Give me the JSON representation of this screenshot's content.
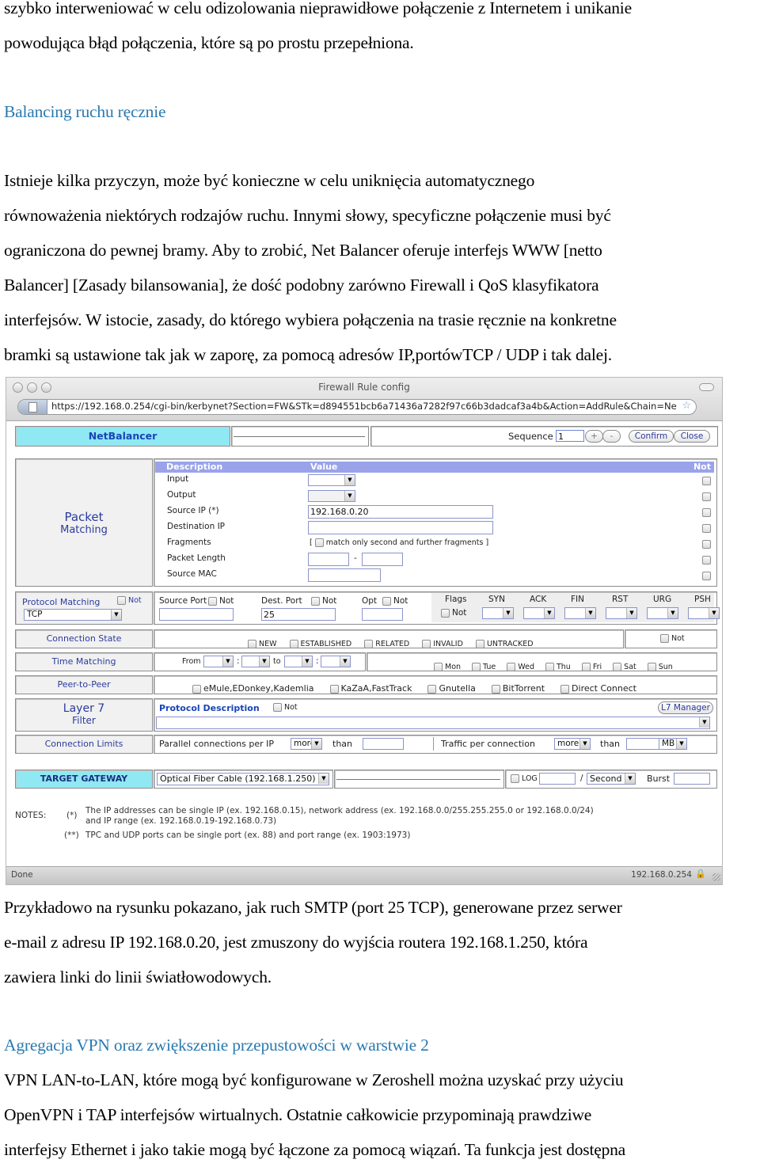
{
  "document": {
    "para_intro": [
      "szybko interweniować w celu odizolowania nieprawidłowe połączenie z Internetem i unikanie",
      "powodująca błąd połączenia, które są po prostu przepełniona."
    ],
    "heading_1": "Balancing ruchu ręcznie",
    "para_1": [
      "Istnieje kilka przyczyn, może być konieczne w celu uniknięcia automatycznego",
      "równoważenia niektórych rodzajów ruchu. Innymi słowy, specyficzne połączenie musi być",
      "ograniczona do pewnej bramy. Aby to zrobić, Net Balancer oferuje interfejs WWW [netto",
      "Balancer] [Zasady bilansowania], że dość podobny zarówno Firewall i QoS klasyfikatora",
      "interfejsów. W istocie, zasady, do którego wybiera połączenia na trasie ręcznie na konkretne",
      "bramki są ustawione tak jak w zaporę, za pomocą adresów IP,portówTCP / UDP i tak dalej."
    ],
    "para_2": [
      "Przykładowo na rysunku pokazano, jak ruch SMTP (port 25 TCP), generowane przez serwer",
      "e-mail z adresu IP 192.168.0.20, jest zmuszony do wyjścia routera 192.168.1.250, która",
      "zawiera linki do linii światłowodowych."
    ],
    "heading_2": "Agregacja VPN oraz zwiększenie przepustowości w warstwie 2",
    "para_3": [
      "VPN LAN-to-LAN, które mogą być konfigurowane w Zeroshell można uzyskać przy użyciu",
      "OpenVPN i TAP interfejsów wirtualnych. Ostatnie całkowicie przypominają prawdziwe",
      "interfejsy Ethernet i jako takie mogą być łączone za pomocą wiązań. Ta funkcja jest dostępna"
    ]
  },
  "browser": {
    "window_title": "Firewall Rule config",
    "url": "https://192.168.0.254/cgi-bin/kerbynet?Section=FW&STk=d894551bcb6a71436a7282f97c66b3dadcaf3a4b&Action=AddRule&Chain=NetBala",
    "status_left": "Done",
    "status_right": "192.168.0.254"
  },
  "form": {
    "header": {
      "title": "NetBalancer",
      "sequence_label": "Sequence",
      "sequence_value": "1",
      "plus_label": "+",
      "minus_label": "-",
      "confirm_label": "Confirm",
      "close_label": "Close"
    },
    "packet_matching": {
      "section_label_1": "Packet",
      "section_label_2": "Matching",
      "col_description": "Description",
      "col_value": "Value",
      "col_not": "Not",
      "rows": [
        {
          "label": "Input",
          "value": ""
        },
        {
          "label": "Output",
          "value": ""
        },
        {
          "label": "Source IP (*)",
          "value": "192.168.0.20"
        },
        {
          "label": "Destination IP",
          "value": ""
        },
        {
          "label": "Fragments",
          "value": "match only second and further fragments"
        },
        {
          "label": "Packet Length",
          "value": ""
        },
        {
          "label": "Source MAC",
          "value": ""
        }
      ],
      "fragments_open": "[",
      "fragments_close": "]",
      "length_sep": "-"
    },
    "protocol": {
      "label": "Protocol Matching",
      "not_label": "Not",
      "value": "TCP",
      "source_port_label": "Source Port",
      "source_port_value": "",
      "dest_port_label": "Dest. Port",
      "dest_port_value": "25",
      "opt_label": "Opt",
      "opt_value": "",
      "flags_label": "Flags",
      "flags": [
        "SYN",
        "ACK",
        "FIN",
        "RST",
        "URG",
        "PSH"
      ]
    },
    "connection_state": {
      "label": "Connection State",
      "options": [
        "NEW",
        "ESTABLISHED",
        "RELATED",
        "INVALID",
        "UNTRACKED"
      ],
      "not_label": "Not"
    },
    "time_matching": {
      "label": "Time Matching",
      "from_label": "From",
      "colon": ":",
      "to_label": "to",
      "days": [
        "Mon",
        "Tue",
        "Wed",
        "Thu",
        "Fri",
        "Sat",
        "Sun"
      ]
    },
    "p2p": {
      "label": "Peer-to-Peer",
      "options": [
        "eMule,EDonkey,Kademlia",
        "KaZaA,FastTrack",
        "Gnutella",
        "BitTorrent",
        "Direct Connect"
      ]
    },
    "layer7": {
      "label_1": "Layer 7",
      "label_2": "Filter",
      "protocol_description": "Protocol Description",
      "not_label": "Not",
      "manager_button": "L7 Manager",
      "selected": ""
    },
    "connection_limits": {
      "label": "Connection Limits",
      "parallel_label": "Parallel connections per IP",
      "parallel_op": "more",
      "than_1": "than",
      "parallel_value": "",
      "traffic_label": "Traffic per connection",
      "traffic_op": "more",
      "than_2": "than",
      "traffic_value": "",
      "traffic_unit": "MB"
    },
    "target": {
      "label": "TARGET GATEWAY",
      "gateway": "Optical Fiber Cable (192.168.1.250)",
      "log_label": "LOG",
      "log_value": "",
      "slash": "/",
      "rate_unit": "Second",
      "burst_label": "Burst",
      "burst_value": ""
    },
    "notes": {
      "label": "NOTES:",
      "mark_1": "(*)",
      "note_1_line_1": "The IP addresses can be single IP (ex. 192.168.0.15), network address (ex. 192.168.0.0/255.255.255.0 or 192.168.0.0/24)",
      "note_1_line_2": "and IP range (ex. 192.168.0.19-192.168.0.73)",
      "mark_2": "(**)",
      "note_2": "TPC and UDP ports can be single port (ex. 88) and port range (ex. 1903:1973)"
    }
  },
  "icons": {
    "star": "☆",
    "lock": "🔒",
    "dropdown": "▼"
  },
  "colors": {
    "heading": "#2a7ab0",
    "header_cyan": "#8fe8f2",
    "table_header": "#9aa3ea",
    "label_blue": "#2d3a9e"
  }
}
